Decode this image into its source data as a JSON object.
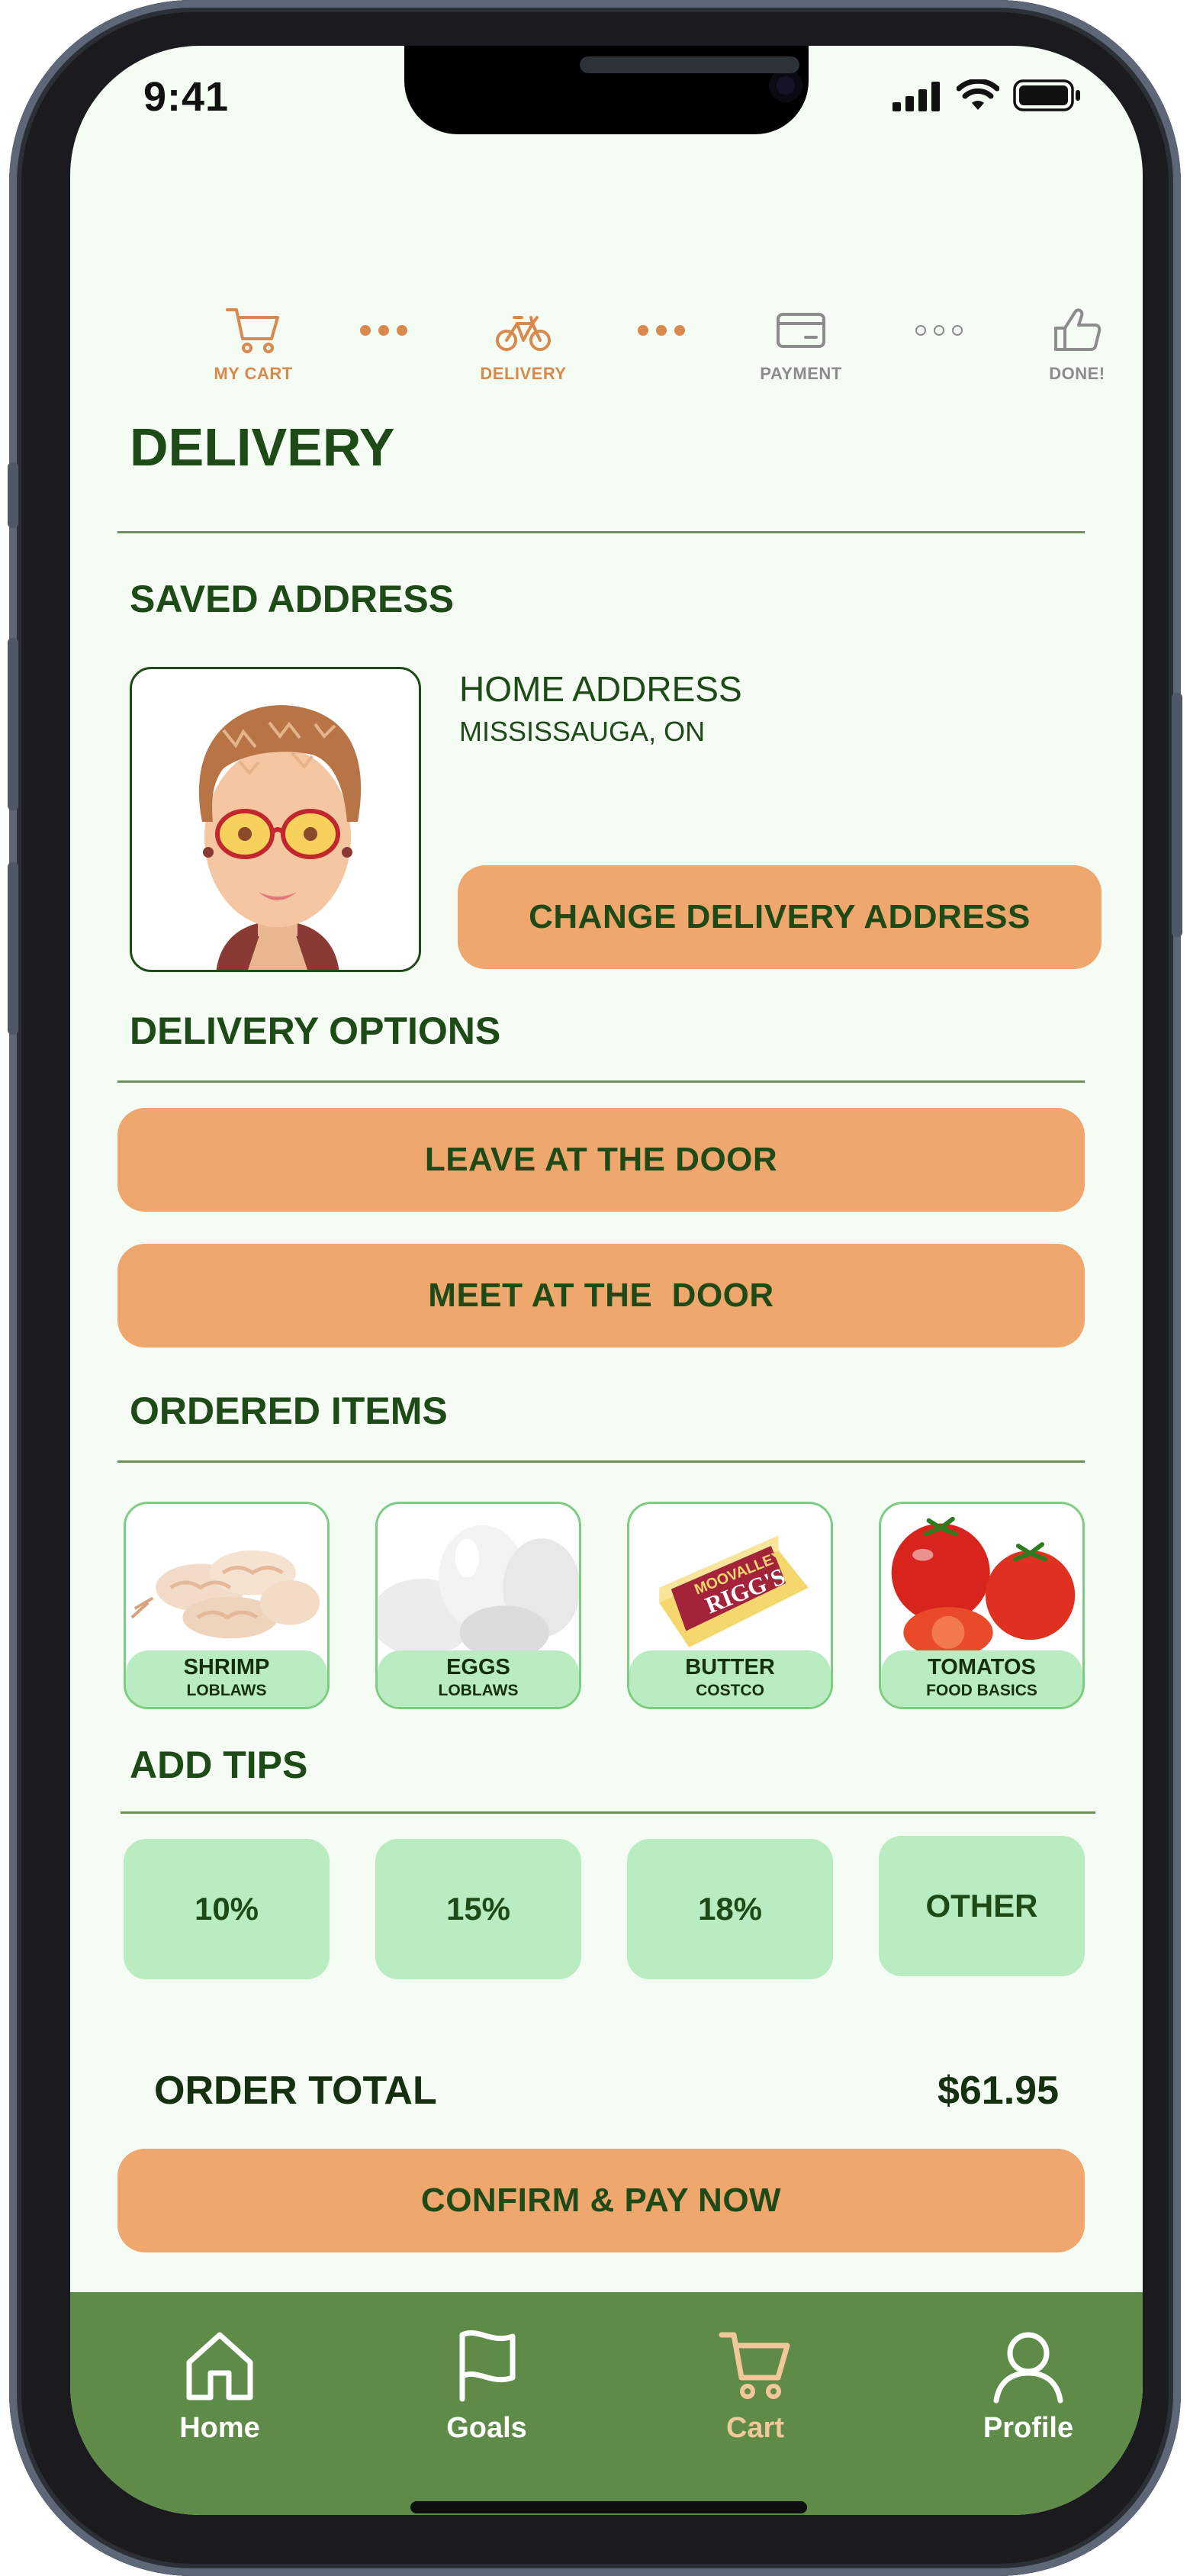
{
  "status_bar": {
    "time": "9:41"
  },
  "progress_steps": [
    {
      "label": "MY CART",
      "icon": "cart-icon",
      "state": "active"
    },
    {
      "label": "DELIVERY",
      "icon": "bicycle-icon",
      "state": "active"
    },
    {
      "label": "PAYMENT",
      "icon": "credit-card-icon",
      "state": "inactive"
    },
    {
      "label": "DONE!",
      "icon": "thumbs-up-icon",
      "state": "inactive"
    }
  ],
  "page": {
    "title": "DELIVERY"
  },
  "saved_address": {
    "heading": "SAVED ADDRESS",
    "address_title": "HOME ADDRESS",
    "address_city": "MISSISSAUGA, ON",
    "change_button": "CHANGE DELIVERY ADDRESS"
  },
  "delivery_options": {
    "heading": "DELIVERY OPTIONS",
    "options": [
      "LEAVE AT THE DOOR",
      "MEET AT THE  DOOR"
    ]
  },
  "ordered_items": {
    "heading": "ORDERED ITEMS",
    "items": [
      {
        "name": "SHRIMP",
        "store": "LOBLAWS"
      },
      {
        "name": "EGGS",
        "store": "LOBLAWS"
      },
      {
        "name": "BUTTER",
        "store": "COSTCO",
        "packaging_text": "MOOVALLEY RIGG'S"
      },
      {
        "name": "TOMATOS",
        "store": "FOOD BASICS"
      }
    ]
  },
  "tips": {
    "heading": "ADD TIPS",
    "options": [
      "10%",
      "15%",
      "18%",
      "OTHER"
    ]
  },
  "order_total": {
    "label": "ORDER TOTAL",
    "value": "$61.95"
  },
  "confirm_button": "CONFIRM & PAY NOW",
  "tab_bar": {
    "tabs": [
      {
        "label": "Home",
        "icon": "home-icon"
      },
      {
        "label": "Goals",
        "icon": "flag-icon"
      },
      {
        "label": "Cart",
        "icon": "cart-icon",
        "active": true
      },
      {
        "label": "Profile",
        "icon": "user-icon"
      }
    ]
  },
  "colors": {
    "background": "#f4fcf4",
    "primary_text": "#1e4a17",
    "accent_orange": "#f0a76e",
    "step_active": "#d9894c",
    "light_green": "#b9ecc0",
    "tab_bar": "#5e8b48",
    "tab_active": "#f2c89a"
  }
}
